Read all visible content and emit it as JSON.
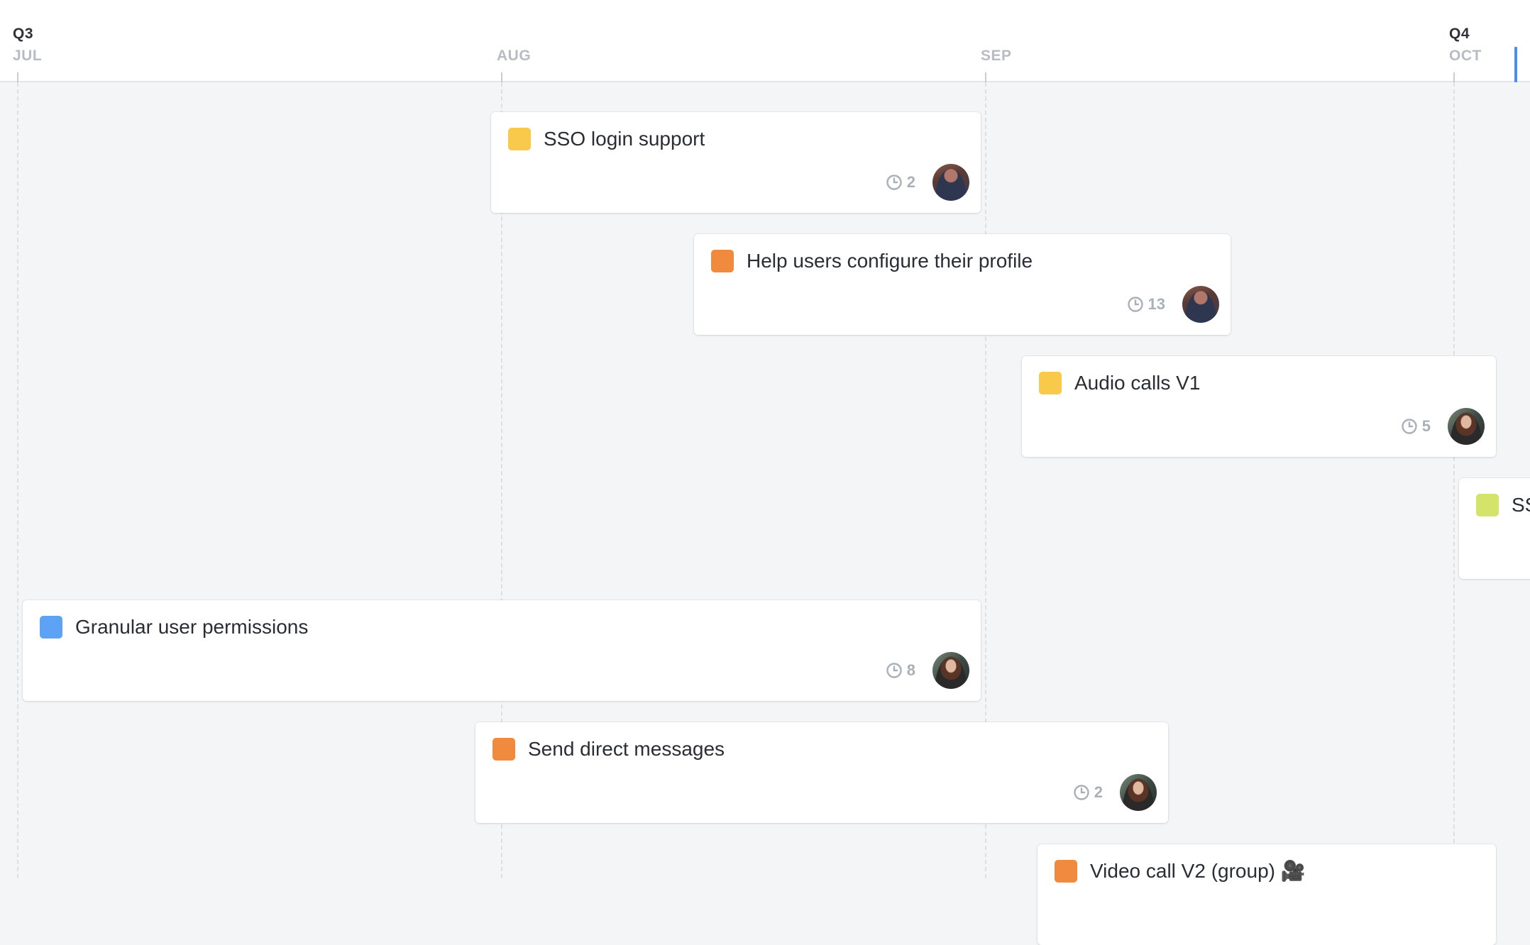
{
  "timeline": {
    "quarters": [
      {
        "label": "Q3"
      },
      {
        "label": "Q4"
      }
    ],
    "months": [
      {
        "label": "JUL"
      },
      {
        "label": "AUG"
      },
      {
        "label": "SEP"
      },
      {
        "label": "OCT"
      }
    ]
  },
  "colors": {
    "yellow": "#f8c94a",
    "orange": "#f08a3e",
    "blue": "#5ea2f5",
    "lime": "#d4e46b",
    "today": "#4c8eef"
  },
  "cards": [
    {
      "title": "SSO login support",
      "color": "#f8c94a",
      "count": "2",
      "avatar": "male"
    },
    {
      "title": "Help users configure their profile",
      "color": "#f08a3e",
      "count": "13",
      "avatar": "male"
    },
    {
      "title": "Audio calls V1",
      "color": "#f8c94a",
      "count": "5",
      "avatar": "female"
    },
    {
      "title": "SS",
      "color": "#d4e46b",
      "count": "",
      "avatar": ""
    },
    {
      "title": "Granular user permissions",
      "color": "#5ea2f5",
      "count": "8",
      "avatar": "female"
    },
    {
      "title": "Send direct messages",
      "color": "#f08a3e",
      "count": "2",
      "avatar": "female"
    },
    {
      "title": "Video call V2 (group) 🎥",
      "color": "#f08a3e",
      "count": "",
      "avatar": ""
    }
  ],
  "icons": {
    "clock": "clock-icon",
    "today": "today-marker"
  }
}
